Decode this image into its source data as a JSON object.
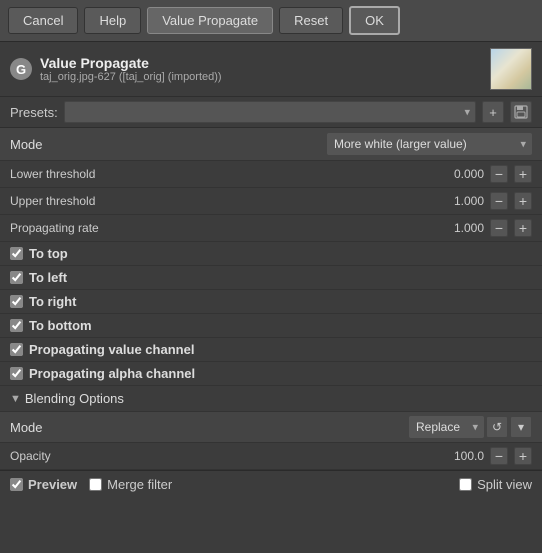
{
  "toolbar": {
    "cancel_label": "Cancel",
    "help_label": "Help",
    "value_propagate_label": "Value Propagate",
    "reset_label": "Reset",
    "ok_label": "OK"
  },
  "header": {
    "g_icon": "G",
    "title": "Value Propagate",
    "subtitle": "taj_orig.jpg-627 ([taj_orig] (imported))"
  },
  "presets": {
    "label": "Presets:",
    "placeholder": "",
    "add_icon": "+",
    "save_icon": "💾"
  },
  "mode": {
    "label": "Mode",
    "value": "More white (larger value)"
  },
  "lower_threshold": {
    "label": "Lower threshold",
    "value": "0.000"
  },
  "upper_threshold": {
    "label": "Upper threshold",
    "value": "1.000"
  },
  "propagating_rate": {
    "label": "Propagating rate",
    "value": "1.000"
  },
  "checkboxes": {
    "to_top": {
      "label": "To top",
      "checked": true
    },
    "to_left": {
      "label": "To left",
      "checked": true
    },
    "to_right": {
      "label": "To right",
      "checked": true
    },
    "to_bottom": {
      "label": "To bottom",
      "checked": true
    },
    "propagating_value_channel": {
      "label": "Propagating value channel",
      "checked": true
    },
    "propagating_alpha_channel": {
      "label": "Propagating alpha channel",
      "checked": true
    }
  },
  "blending_options": {
    "section_title": "Blending Options",
    "mode_label": "Mode",
    "mode_value": "Replace",
    "opacity_label": "Opacity",
    "opacity_value": "100.0"
  },
  "footer": {
    "preview_label": "Preview",
    "preview_checked": true,
    "merge_filter_label": "Merge filter",
    "merge_filter_checked": false,
    "split_view_label": "Split view",
    "split_view_checked": false
  }
}
